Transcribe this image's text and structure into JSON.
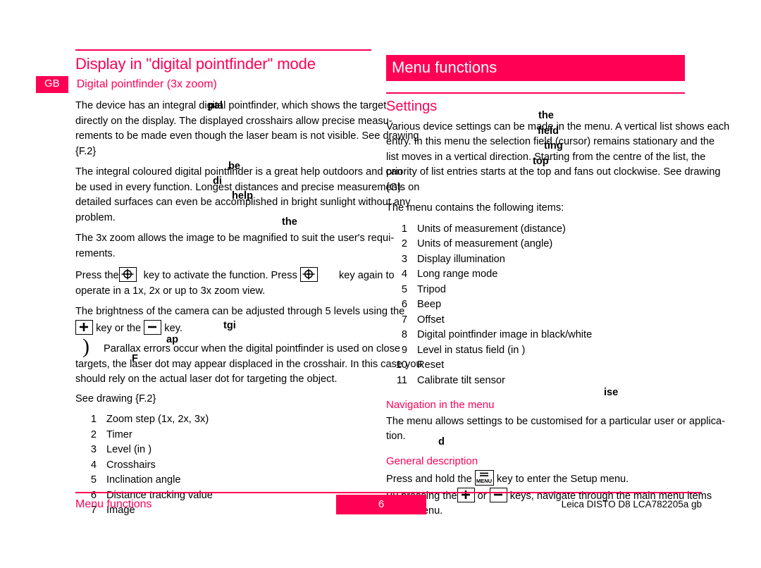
{
  "meta": {
    "accent_color": "#FF0055",
    "text_color": "#000000",
    "page_background": "#FFFFFF"
  },
  "left_column": {
    "chapter_title": "Display in \"digital pointfinder\" mode",
    "language_badge": "GB",
    "sub_heading": "Digital pointfinder (3x zoom)",
    "paragraph_1": {
      "lines": [
        "The device has an integral digital pointfinder, which shows the target",
        "directly on the display. The displayed crosshairs allow precise measu-",
        "rements to be made even though the laser beam is not visible. See drawing",
        "{F.2}"
      ],
      "overlap_words": [
        "pal",
        "."
      ]
    },
    "paragraph_2": {
      "lines": [
        "The integral coloured digital pointfinder is a great help outdoors and can",
        "be used in every function. Longest distances and precise measurements on",
        "detailed surfaces can even be accomplished in bright sunlight without any",
        "problem."
      ],
      "overlap_words": [
        "be",
        "di",
        "help"
      ]
    },
    "paragraph_3": {
      "lines": [
        "The 3x zoom allows the image to be magnified to suit the user's requi-",
        "rements."
      ],
      "overlap_words": [
        "the"
      ]
    },
    "paragraph_4": {
      "before_key_1": "Press the",
      "key_1_icon": "crosshair-key-icon",
      "after_key_1": "key to activate the function. Press",
      "key_2_icon": "crosshair-key-icon",
      "after_key_2": "key again to",
      "line_2": "operate in a 1x, 2x or up to 3x zoom view."
    },
    "paragraph_5": {
      "line_1": "The brightness of the camera can be adjusted through 5 levels using the",
      "line_2_before": "key or the",
      "plus_key_icon": "plus-key-icon",
      "minus_key_icon": "minus-key-icon",
      "line_2_after": "key."
    },
    "note": {
      "glyph": ")",
      "lines": [
        "Parallax errors occur when the digital pointfinder is used on close",
        "targets, the laser dot may appear displaced in the crosshair. In this case you",
        "should rely on the actual laser dot for targeting the object."
      ],
      "overlap_words": [
        "tgi",
        "ap"
      ]
    },
    "see_drawing": "See drawing {F.2}",
    "see_drawing_overlap": "F",
    "legend_items": [
      {
        "num": "1",
        "label": "Zoom step (1x, 2x, 3x)"
      },
      {
        "num": "2",
        "label": "Timer"
      },
      {
        "num": "3",
        "label": "Level (in  )"
      },
      {
        "num": "4",
        "label": "Crosshairs"
      },
      {
        "num": "5",
        "label": "Inclination angle"
      },
      {
        "num": "6",
        "label": "Distance tracking value"
      },
      {
        "num": "7",
        "label": "Image"
      }
    ]
  },
  "right_column": {
    "banner_title": "Menu functions",
    "section_title": "Settings",
    "paragraph_1": {
      "lines": [
        "Various device settings can be made in the menu. A vertical list shows each",
        "entry. In this menu the selection field (cursor) remains stationary and the",
        "list moves in a vertical direction. Starting from the centre of the list, the",
        "priority of list entries starts at the top and fans out clockwise. See drawing",
        "{G}."
      ],
      "overlap_words": [
        "the",
        "field",
        "ting",
        "top"
      ]
    },
    "intro_list": "The menu contains the following items:",
    "menu_items": [
      {
        "num": "1",
        "label": "Units of measurement (distance)"
      },
      {
        "num": "2",
        "label": "Units of measurement (angle)"
      },
      {
        "num": "3",
        "label": "Display illumination"
      },
      {
        "num": "4",
        "label": "Long range mode"
      },
      {
        "num": "5",
        "label": "Tripod"
      },
      {
        "num": "6",
        "label": "Beep"
      },
      {
        "num": "7",
        "label": "Offset"
      },
      {
        "num": "8",
        "label": "Digital pointfinder image in black/white"
      },
      {
        "num": "9",
        "label": "Level in status field (in  )"
      },
      {
        "num": "10",
        "label": "Reset"
      },
      {
        "num": "11",
        "label": "Calibrate tilt sensor"
      }
    ],
    "navigation": {
      "title": "Navigation in the menu",
      "lines": [
        "The menu allows settings to be customised for a particular user or applica-",
        "tion."
      ],
      "overlap_words": [
        "ise"
      ]
    },
    "general": {
      "title": "General description",
      "line_1_before": "Press and hold  the",
      "menu_key_icon": "menu-key-icon",
      "menu_key_label": "MENU",
      "line_1_after": "key to enter the Setup menu.",
      "line_2_before": "By pressing the",
      "plus_key_icon": "plus-key-icon",
      "line_2_mid": "or",
      "minus_key_icon": "minus-key-icon",
      "line_2_after": "keys, navigate through the main menu items",
      "line_3": "in the menu.",
      "overlap_words": [
        "d"
      ]
    }
  },
  "footer": {
    "left_label": "Menu functions",
    "page_number": "6",
    "right_label": "Leica DISTO  D8 LCA782205a gb"
  }
}
